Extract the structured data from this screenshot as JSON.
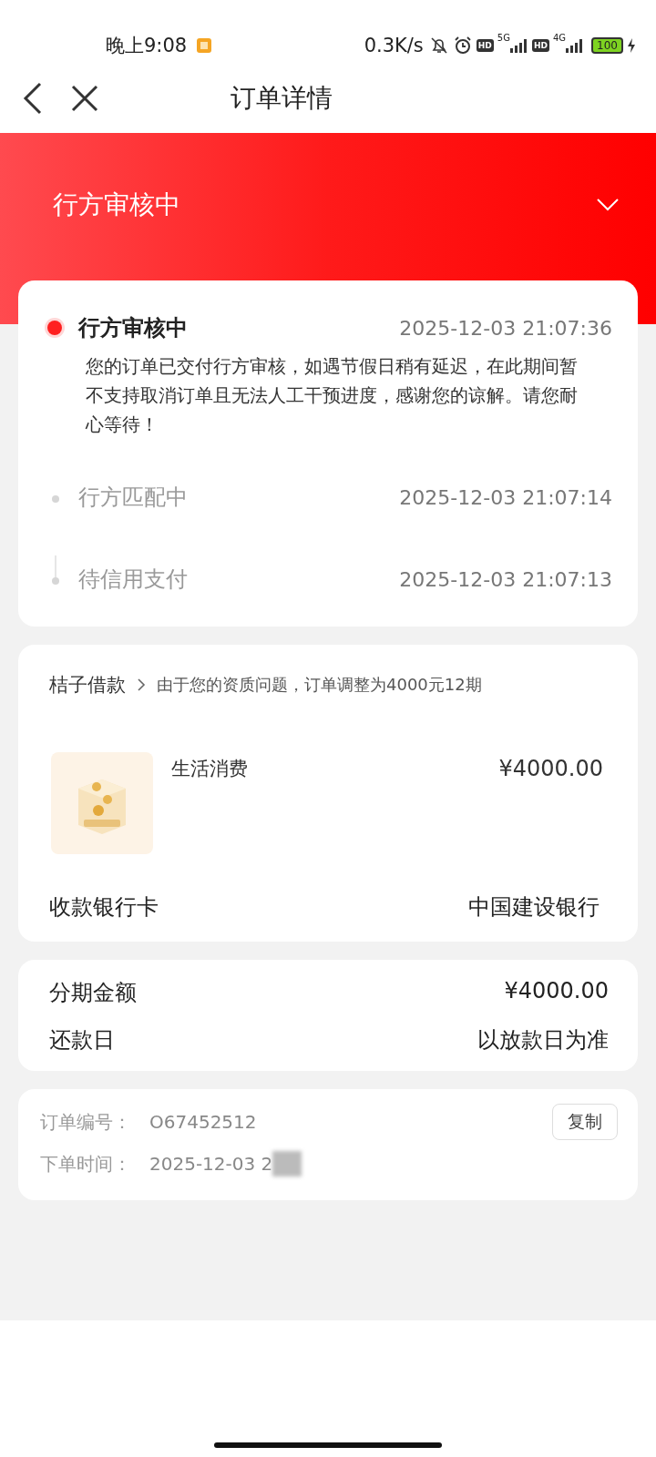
{
  "status_bar": {
    "time": "晚上9:08",
    "speed": "0.3K/s",
    "hd_1": "HD",
    "network_1": "5G",
    "hd_2": "HD",
    "network_2": "4G",
    "battery": "100"
  },
  "nav": {
    "title": "订单详情"
  },
  "header": {
    "status": "行方审核中",
    "expanded": false
  },
  "timeline": [
    {
      "title": "行方审核中",
      "time": "2025-12-03 21:07:36",
      "active": true,
      "description": "您的订单已交付行方审核，如遇节假日稍有延迟，在此期间暂不支持取消订单且无法人工干预进度，感谢您的谅解。请您耐心等待！"
    },
    {
      "title": "行方匹配中",
      "time": "2025-12-03 21:07:14",
      "active": false
    },
    {
      "title": "待信用支付",
      "time": "2025-12-03 21:07:13",
      "active": false
    }
  ],
  "loan": {
    "provider": "桔子借款",
    "notice": "由于您的资质问题，订单调整为4000元12期",
    "product": "生活消费",
    "amount": "¥4000.00",
    "bank_label": "收款银行卡",
    "bank": "中国建设银行"
  },
  "terms": [
    {
      "label": "分期金额",
      "value": "¥4000.00"
    },
    {
      "label": "还款日",
      "value": "以放款日为准"
    }
  ],
  "order": {
    "number_label": "订单编号：",
    "number": "O67452512",
    "time_label": "下单时间：",
    "time": "2025-12-03 2",
    "copy": "复制"
  }
}
